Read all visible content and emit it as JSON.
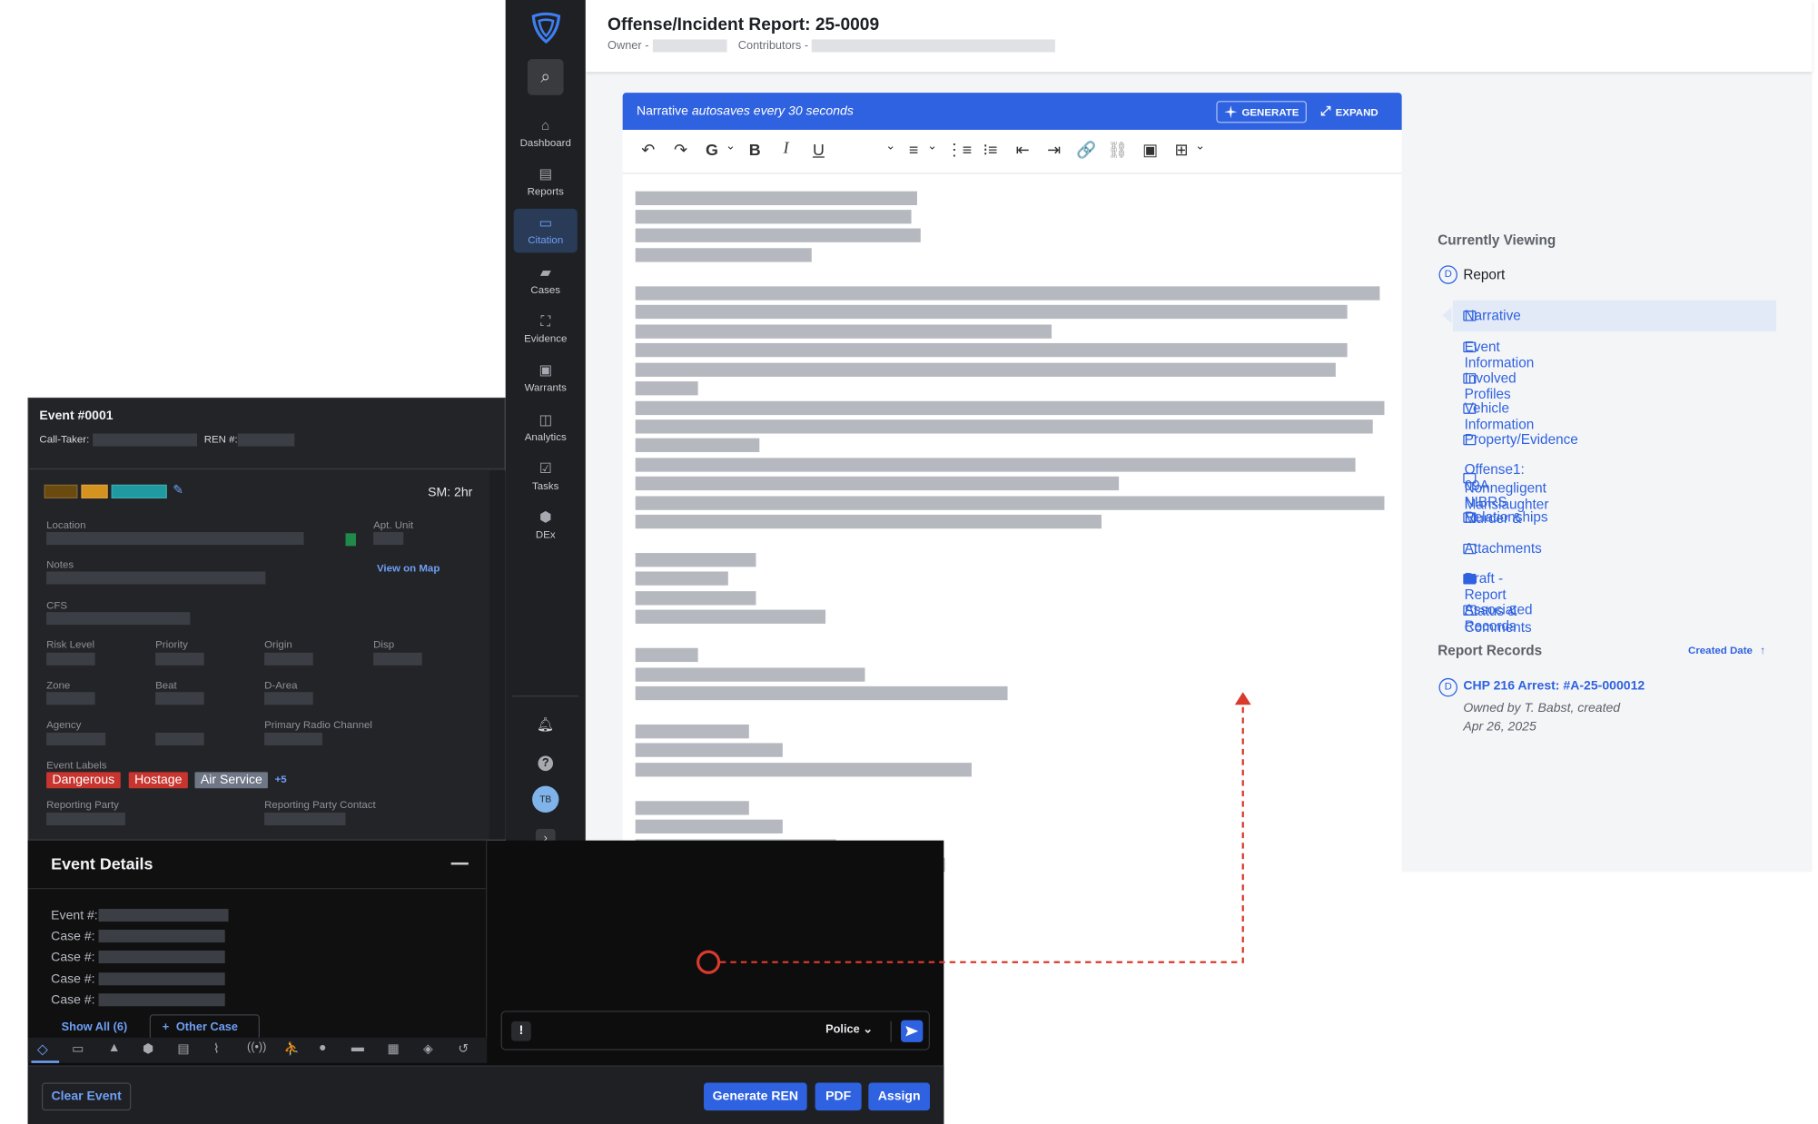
{
  "header": {
    "title": "Offense/Incident Report: 25-0009",
    "owner_label": "Owner -",
    "contributors_label": "Contributors -"
  },
  "editor": {
    "banner_prefix": "Narrative ",
    "banner_italic": "autosaves every 30 seconds",
    "generate_label": "GENERATE",
    "expand_label": "EXPAND",
    "toolbar_font": "G"
  },
  "sidebar": {
    "items": [
      {
        "label": "Dashboard",
        "icon": "home-icon"
      },
      {
        "label": "Reports",
        "icon": "document-icon"
      },
      {
        "label": "Citation",
        "icon": "citation-icon"
      },
      {
        "label": "Cases",
        "icon": "folder-icon"
      },
      {
        "label": "Evidence",
        "icon": "evidence-icon"
      },
      {
        "label": "Warrants",
        "icon": "warrant-icon"
      },
      {
        "label": "Analytics",
        "icon": "analytics-icon"
      },
      {
        "label": "Tasks",
        "icon": "tasks-icon"
      },
      {
        "label": "DEx",
        "icon": "hexagon-icon"
      }
    ],
    "active": "Citation",
    "avatar": "TB"
  },
  "right_panel": {
    "currently_viewing": "Currently Viewing",
    "report_badge": "D",
    "report_label": "Report",
    "nav": [
      "Narrative",
      "Event Information",
      "Involved Profiles",
      "Vehicle Information",
      "Property/Evidence",
      "Offense1: 09A NIBRS Murder &",
      "Nonnegligent Manslaughter",
      "Relationships",
      "Attachments",
      "Draft - Report Status & Comments",
      "Associated Records"
    ],
    "records_title": "Report Records",
    "sort_label": "Created Date",
    "sort_arrow": "↑",
    "record_badge": "D",
    "record_title": "CHP 216 Arrest: #A-25-000012",
    "record_owner": "Owned by T. Babst, created",
    "record_date": "Apr 26, 2025"
  },
  "event": {
    "title": "Event #0001",
    "call_taker_label": "Call-Taker:",
    "ren_label": "REN #:",
    "sm": "SM: 2hr",
    "status_colors": [
      "#6b4a10",
      "#d4921e",
      "#1e9aa0"
    ],
    "location_label": "Location",
    "apt_label": "Apt. Unit",
    "notes_label": "Notes",
    "view_map": "View on Map",
    "cfs_label": "CFS",
    "risk_label": "Risk Level",
    "priority_label": "Priority",
    "origin_label": "Origin",
    "disp_label": "Disp",
    "zone_label": "Zone",
    "beat_label": "Beat",
    "darea_label": "D-Area",
    "agency_label": "Agency",
    "radio_label": "Primary Radio Channel",
    "labels_label": "Event Labels",
    "tags": [
      {
        "text": "Dangerous",
        "color": "#c8352f"
      },
      {
        "text": "Hostage",
        "color": "#c8352f"
      },
      {
        "text": "Air Service",
        "color": "#6f7786"
      }
    ],
    "tags_more": "+5",
    "rp_label": "Reporting Party",
    "rpc_label": "Reporting Party Contact"
  },
  "details": {
    "title": "Event Details",
    "rows": [
      "Event #:",
      "Case #:",
      "Case #:",
      "Case #:",
      "Case #:"
    ],
    "show_all": "Show All (6)",
    "other_case": "Other Case"
  },
  "chat": {
    "channel": "Police",
    "alert_glyph": "!"
  },
  "footer": {
    "clear": "Clear Event",
    "generate_ren": "Generate REN",
    "pdf": "PDF",
    "assign": "Assign"
  }
}
